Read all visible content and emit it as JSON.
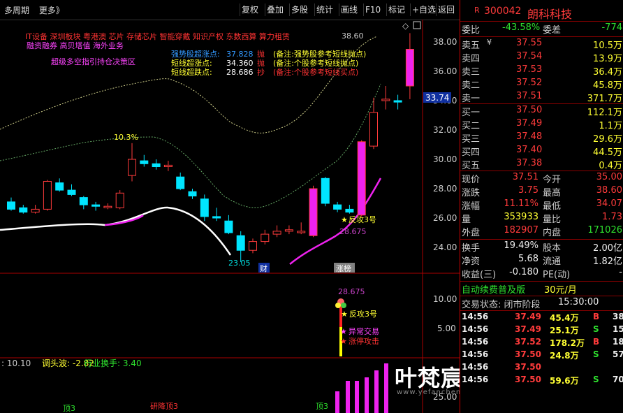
{
  "toolbar": {
    "left": [
      "多周期",
      "更多》"
    ],
    "buttons": [
      "复权",
      "叠加",
      "多股",
      "统计",
      "画线",
      "F10",
      "标记",
      "+自选",
      "返回"
    ]
  },
  "stock": {
    "code": "300042",
    "name": "朗科科技",
    "flag": "R"
  },
  "ratio": {
    "label1": "委比",
    "v1": "-43.58%",
    "label2": "委差",
    "v2": "-774"
  },
  "sell": [
    {
      "label": "卖五",
      "mark": "¥",
      "price": "37.55",
      "vol": "10.5万"
    },
    {
      "label": "卖四",
      "mark": "",
      "price": "37.54",
      "vol": "13.9万"
    },
    {
      "label": "卖三",
      "mark": "",
      "price": "37.53",
      "vol": "36.4万"
    },
    {
      "label": "卖二",
      "mark": "",
      "price": "37.52",
      "vol": "45.8万"
    },
    {
      "label": "卖一",
      "mark": "",
      "price": "37.51",
      "vol": "371.7万"
    }
  ],
  "buy": [
    {
      "label": "买一",
      "price": "37.50",
      "vol": "112.1万"
    },
    {
      "label": "买二",
      "price": "37.49",
      "vol": "1.1万"
    },
    {
      "label": "买三",
      "price": "37.48",
      "vol": "29.6万"
    },
    {
      "label": "买四",
      "price": "37.40",
      "vol": "44.5万"
    },
    {
      "label": "买五",
      "price": "37.38",
      "vol": "0.4万"
    }
  ],
  "quote": [
    {
      "l1": "现价",
      "v1": "37.51",
      "l2": "今开",
      "v2": "35.00"
    },
    {
      "l1": "涨跌",
      "v1": "3.75",
      "l2": "最高",
      "v2": "38.60"
    },
    {
      "l1": "涨幅",
      "v1": "11.11%",
      "l2": "最低",
      "v2": "34.07"
    },
    {
      "l1": "量",
      "v1": "353933",
      "l2": "量比",
      "v2": "1.73"
    },
    {
      "l1": "外盘",
      "v1": "182907",
      "l2": "内盘",
      "v2": "171026"
    }
  ],
  "finance": [
    {
      "l1": "换手",
      "v1": "19.49%",
      "l2": "股本",
      "v2": "2.00亿"
    },
    {
      "l1": "净资",
      "v1": "5.68",
      "l2": "流通",
      "v2": "1.82亿"
    },
    {
      "l1": "收益(三)",
      "v1": "-0.180",
      "l2": "PE(动)",
      "v2": "-"
    }
  ],
  "ad": {
    "text": "自动续费普及版",
    "price": "30元/月"
  },
  "trade_status": {
    "label": "交易状态: 闭市阶段",
    "time": "15:30:00"
  },
  "ticks": [
    {
      "t": "14:56",
      "p": "37.49",
      "v": "45.4万",
      "d": "B",
      "n": "38"
    },
    {
      "t": "14:56",
      "p": "37.49",
      "v": "25.1万",
      "d": "S",
      "n": "15"
    },
    {
      "t": "14:56",
      "p": "37.52",
      "v": "178.2万",
      "d": "B",
      "n": "18"
    },
    {
      "t": "14:56",
      "p": "37.50",
      "v": "24.8万",
      "d": "S",
      "n": "57"
    },
    {
      "t": "14:56",
      "p": "37.50",
      "v": "",
      "d": "",
      "n": ""
    },
    {
      "t": "14:56",
      "p": "37.50",
      "v": "59.6万",
      "d": "S",
      "n": "70"
    }
  ],
  "price_axis": {
    "ticks": [
      "38.00",
      "36.00",
      "34.00",
      "32.00",
      "30.00",
      "28.00",
      "26.00",
      "24.00"
    ],
    "current": "33.74"
  },
  "ind_axis": {
    "ticks": [
      "10.00",
      "5.00"
    ]
  },
  "macd_axis": {
    "ticks": [
      "25.00"
    ]
  },
  "annotations": {
    "concepts1": "IT设备    深圳板块    粤港澳 芯片 存储芯片 智能穿戴 知识产权 东数西算 算力租赁",
    "concepts2": "融资融券 高贝塔值 海外业务",
    "super": "超级多空指引持仓决策区",
    "l1_name": "强势股超涨点:",
    "l1_val": "37.828",
    "l1_act": "抛",
    "l1_note": "(备注:强势股参考短线抛点)",
    "l2_name": "短线超涨点:",
    "l2_val": "34.360",
    "l2_act": "抛",
    "l2_note": "(备注:个股参考短线抛点)",
    "l3_name": "短线超跌点:",
    "l3_val": "28.686",
    "l3_act": "抄",
    "l3_note": "(备注:个股参考短线买点)",
    "high": "38.60",
    "pct": "10.3%",
    "low": "23.05",
    "cai": "财",
    "zhangbang": "涨榜",
    "fangong": "反攻3号",
    "fg_val": "28.675",
    "ind_val": "28.675",
    "ind_fangong": "反攻3号",
    "ind_yichang": "异常交易",
    "ind_zhangting": "涨停攻击",
    "bottom_label": ": 10.10",
    "bottom_tiaotou": "调头波: -2.82",
    "bottom_huanshou": "行业换手: 3.40",
    "d1": "顶3",
    "d2": "顶3",
    "ld": "研降顶3"
  },
  "watermark": "叶梵宸指标公式网",
  "watermark_sub": "www.yefanchen.com",
  "chart_data": {
    "type": "candlestick",
    "ohlc": [
      {
        "o": 27.1,
        "h": 27.4,
        "l": 26.5,
        "c": 26.6
      },
      {
        "o": 26.7,
        "h": 26.9,
        "l": 26.3,
        "c": 26.4
      },
      {
        "o": 26.4,
        "h": 26.9,
        "l": 26.3,
        "c": 26.6
      },
      {
        "o": 26.6,
        "h": 28.6,
        "l": 26.5,
        "c": 28.5
      },
      {
        "o": 28.4,
        "h": 28.7,
        "l": 27.8,
        "c": 27.9
      },
      {
        "o": 27.9,
        "h": 28.3,
        "l": 27.5,
        "c": 27.6
      },
      {
        "o": 27.4,
        "h": 27.5,
        "l": 26.6,
        "c": 26.9
      },
      {
        "o": 26.9,
        "h": 27.1,
        "l": 26.5,
        "c": 26.8
      },
      {
        "o": 26.7,
        "h": 27.0,
        "l": 26.6,
        "c": 26.8
      },
      {
        "o": 26.7,
        "h": 27.9,
        "l": 26.6,
        "c": 27.7
      },
      {
        "o": 28.9,
        "h": 31.1,
        "l": 28.5,
        "c": 30.0
      },
      {
        "o": 29.9,
        "h": 30.3,
        "l": 29.5,
        "c": 29.7
      },
      {
        "o": 29.7,
        "h": 30.0,
        "l": 29.3,
        "c": 29.5
      },
      {
        "o": 29.5,
        "h": 29.9,
        "l": 29.2,
        "c": 29.6
      },
      {
        "o": 28.8,
        "h": 29.1,
        "l": 27.9,
        "c": 28.0
      },
      {
        "o": 27.8,
        "h": 28.0,
        "l": 27.3,
        "c": 27.5
      },
      {
        "o": 27.3,
        "h": 27.6,
        "l": 25.8,
        "c": 26.1
      },
      {
        "o": 26.1,
        "h": 26.7,
        "l": 25.8,
        "c": 26.0
      },
      {
        "o": 25.8,
        "h": 26.2,
        "l": 24.9,
        "c": 25.0
      },
      {
        "o": 24.8,
        "h": 25.1,
        "l": 23.0,
        "c": 23.8
      },
      {
        "o": 23.8,
        "h": 24.6,
        "l": 23.6,
        "c": 24.4
      },
      {
        "o": 24.4,
        "h": 25.2,
        "l": 24.2,
        "c": 24.9
      },
      {
        "o": 24.9,
        "h": 25.5,
        "l": 24.7,
        "c": 25.1
      },
      {
        "o": 25.1,
        "h": 25.5,
        "l": 24.9,
        "c": 25.2
      },
      {
        "o": 25.0,
        "h": 25.7,
        "l": 24.9,
        "c": 25.1
      },
      {
        "o": 24.8,
        "h": 28.2,
        "l": 24.7,
        "c": 28.0
      },
      {
        "o": 28.7,
        "h": 28.8,
        "l": 26.8,
        "c": 27.0
      },
      {
        "o": 26.9,
        "h": 27.1,
        "l": 26.4,
        "c": 26.6
      },
      {
        "o": 26.6,
        "h": 26.9,
        "l": 26.3,
        "c": 26.4
      },
      {
        "o": 26.2,
        "h": 31.3,
        "l": 26.1,
        "c": 31.2
      },
      {
        "o": 30.9,
        "h": 34.2,
        "l": 30.7,
        "c": 33.2
      },
      {
        "o": 34.0,
        "h": 35.0,
        "l": 33.4,
        "c": 34.1
      },
      {
        "o": 34.0,
        "h": 34.4,
        "l": 33.4,
        "c": 33.9
      },
      {
        "o": 35.0,
        "h": 38.6,
        "l": 34.1,
        "c": 37.5
      }
    ],
    "ylim": [
      23.0,
      38.6
    ]
  }
}
